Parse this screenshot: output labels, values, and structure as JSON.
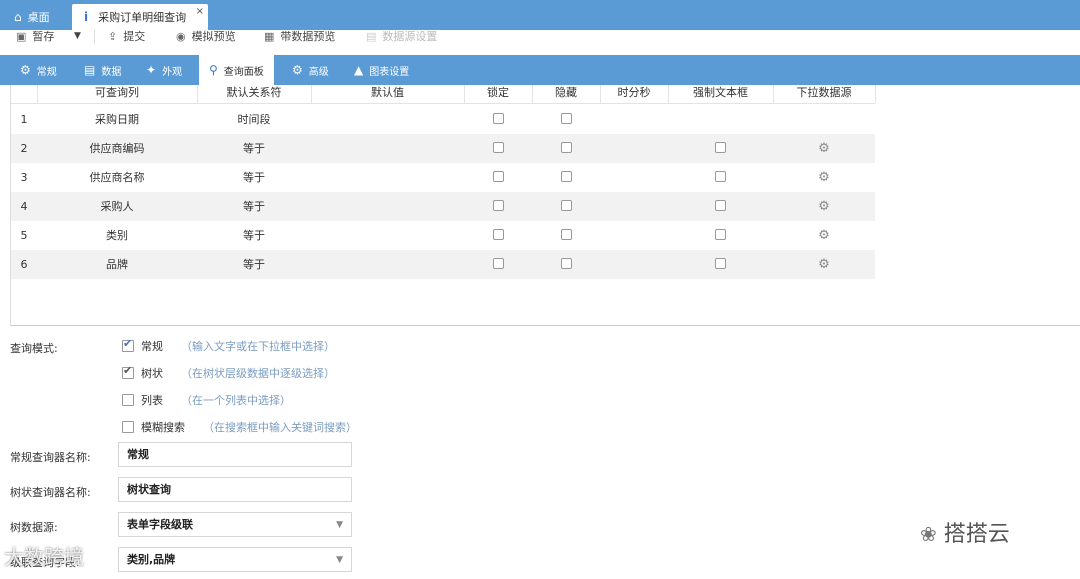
{
  "tabs": {
    "home_label": "桌面",
    "active_label": "采购订单明细查询",
    "close_glyph": "×"
  },
  "toolbar": {
    "save_label": "暂存",
    "submit_label": "提交",
    "preview_label": "模拟预览",
    "data_preview_label": "带数据预览",
    "datasource_label": "数据源设置"
  },
  "subtabs": {
    "general": "常规",
    "data": "数据",
    "appearance": "外观",
    "query_panel": "查询面板",
    "advanced": "高级",
    "chart_settings": "图表设置"
  },
  "grid": {
    "headers": [
      "可查询列",
      "默认关系符",
      "默认值",
      "锁定",
      "隐藏",
      "时分秒",
      "强制文本框",
      "下拉数据源"
    ],
    "rows": [
      {
        "no": "1",
        "column": "采购日期",
        "relation": "时间段"
      },
      {
        "no": "2",
        "column": "供应商编码",
        "relation": "等于"
      },
      {
        "no": "3",
        "column": "供应商名称",
        "relation": "等于"
      },
      {
        "no": "4",
        "column": "采购人",
        "relation": "等于"
      },
      {
        "no": "5",
        "column": "类别",
        "relation": "等于"
      },
      {
        "no": "6",
        "column": "品牌",
        "relation": "等于"
      }
    ]
  },
  "form": {
    "mode_label": "查询模式:",
    "modes": [
      {
        "label": "常规",
        "hint": "（输入文字或在下拉框中选择）",
        "checked": true
      },
      {
        "label": "树状",
        "hint": "（在树状层级数据中逐级选择）",
        "checked": true
      },
      {
        "label": "列表",
        "hint": "（在一个列表中选择）",
        "checked": false
      },
      {
        "label": "模糊搜索",
        "hint": "（在搜索框中输入关键词搜索）",
        "checked": false
      }
    ],
    "normal_name_label": "常规查询器名称:",
    "normal_name_value": "常规",
    "tree_name_label": "树状查询器名称:",
    "tree_name_value": "树状查询",
    "tree_source_label": "树数据源:",
    "tree_source_value": "表单字段级联",
    "cascade_label": "级联查询字段:",
    "cascade_value": "类别,品牌"
  },
  "watermarks": {
    "right": "搭搭云",
    "left": "大数跨境"
  }
}
